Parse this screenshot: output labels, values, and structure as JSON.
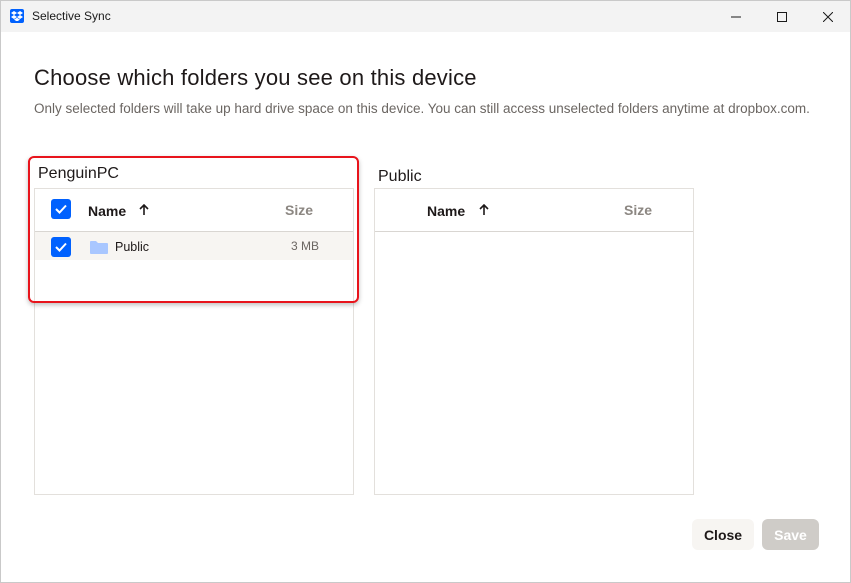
{
  "window": {
    "title": "Selective Sync",
    "app_icon": "dropbox-icon"
  },
  "main": {
    "heading": "Choose which folders you see on this device",
    "subtext": "Only selected folders will take up hard drive space on this device. You can still access unselected folders anytime at dropbox.com."
  },
  "left_pane": {
    "label": "PenguinPC",
    "header": {
      "name": "Name",
      "size": "Size",
      "select_all_checked": true
    },
    "rows": [
      {
        "name": "Public",
        "size": "3 MB",
        "checked": true
      }
    ]
  },
  "right_pane": {
    "label": "Public",
    "header": {
      "name": "Name",
      "size": "Size"
    },
    "rows": []
  },
  "footer": {
    "close_label": "Close",
    "save_label": "Save"
  },
  "colors": {
    "accent": "#0061fe",
    "highlight_border": "#e8141c",
    "save_disabled": "#cfccc8"
  }
}
